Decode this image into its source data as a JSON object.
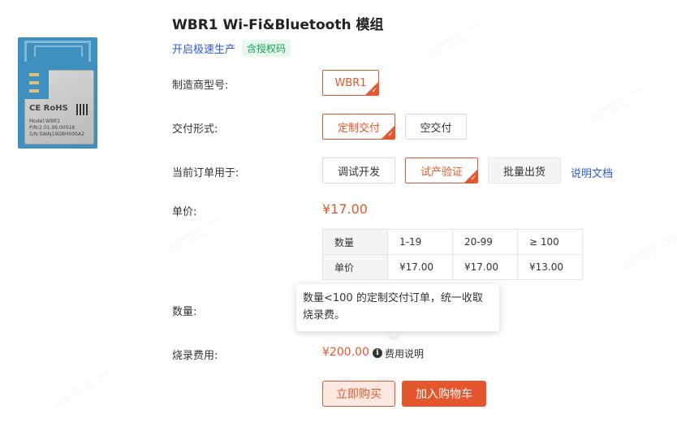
{
  "product": {
    "title": "WBR1 Wi-Fi&Bluetooth 模组",
    "fast_link": "开启极速生产",
    "auth_badge": "含授权码",
    "image_text": {
      "ce": "CE RoHS",
      "model": "Model:WBR1",
      "pn": "P/N:2.01.99.00018",
      "sn": "S/N:SWAJ19DBH000A2"
    }
  },
  "manufacturer_model": {
    "label": "制造商型号:",
    "options": [
      "WBR1"
    ],
    "selected": "WBR1"
  },
  "delivery": {
    "label": "交付形式:",
    "options": [
      "定制交付",
      "空交付"
    ],
    "selected": "定制交付"
  },
  "order_use": {
    "label": "当前订单用于:",
    "options": [
      "调试开发",
      "试产验证",
      "批量出货"
    ],
    "selected": "试产验证",
    "doc_link": "说明文档"
  },
  "unit_price": {
    "label": "单价:",
    "price": "¥17.00",
    "table": {
      "rows": [
        [
          "数量",
          "1-19",
          "20-99",
          "≥ 100"
        ],
        [
          "单价",
          "¥17.00",
          "¥17.00",
          "¥13.00"
        ]
      ]
    }
  },
  "quantity": {
    "label": "数量:",
    "tooltip": "数量<100 的定制交付订单，统一收取烧录费。"
  },
  "burn_fee": {
    "label": "烧录费用:",
    "price": "¥200.00",
    "info_icon": "info-icon",
    "note": "费用说明"
  },
  "actions": {
    "buy_now": "立即购买",
    "add_to_cart": "加入购物车"
  },
  "watermark": "涂鸦智能-39",
  "colors": {
    "accent": "#e4572e",
    "link": "#2a58d6",
    "badge_green": "#18a058"
  }
}
